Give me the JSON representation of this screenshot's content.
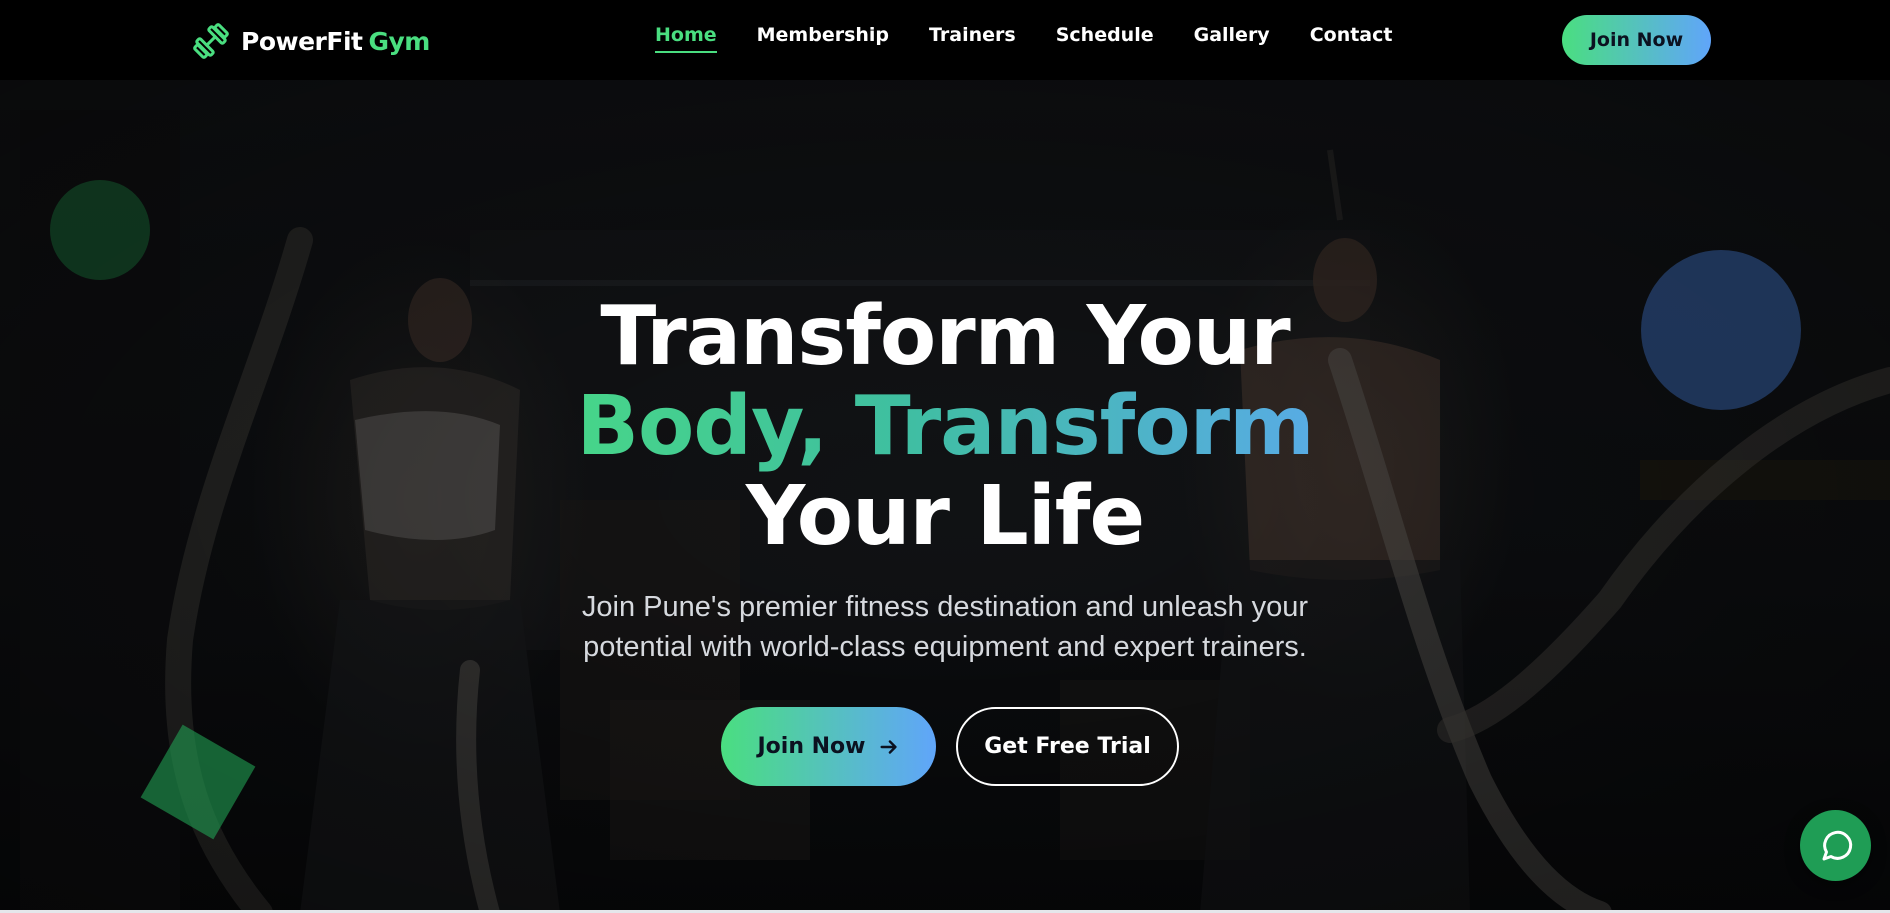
{
  "header": {
    "logo_brand": "PowerFit",
    "logo_accent": "Gym",
    "logo_icon": "dumbbell-icon",
    "nav": [
      {
        "label": "Home",
        "active": true
      },
      {
        "label": "Membership",
        "active": false
      },
      {
        "label": "Trainers",
        "active": false
      },
      {
        "label": "Schedule",
        "active": false
      },
      {
        "label": "Gallery",
        "active": false
      },
      {
        "label": "Contact",
        "active": false
      }
    ],
    "cta_label": "Join Now"
  },
  "hero": {
    "headline": {
      "line1": "Transform Your",
      "line2": "Body, Transform",
      "line3": "Your Life"
    },
    "subtitle_line1": "Join Pune's premier fitness destination and unleash your",
    "subtitle_line2": "potential with world-class equipment and expert trainers.",
    "primary_button": "Join Now",
    "primary_button_icon": "arrow-right-icon",
    "secondary_button": "Get Free Trial"
  },
  "chat_widget": {
    "icon": "chat-bubble-icon"
  },
  "colors": {
    "accent_green": "#4ade80",
    "accent_blue": "#60a5fa",
    "header_bg": "#000000",
    "chat_bg": "#1f9d55"
  }
}
